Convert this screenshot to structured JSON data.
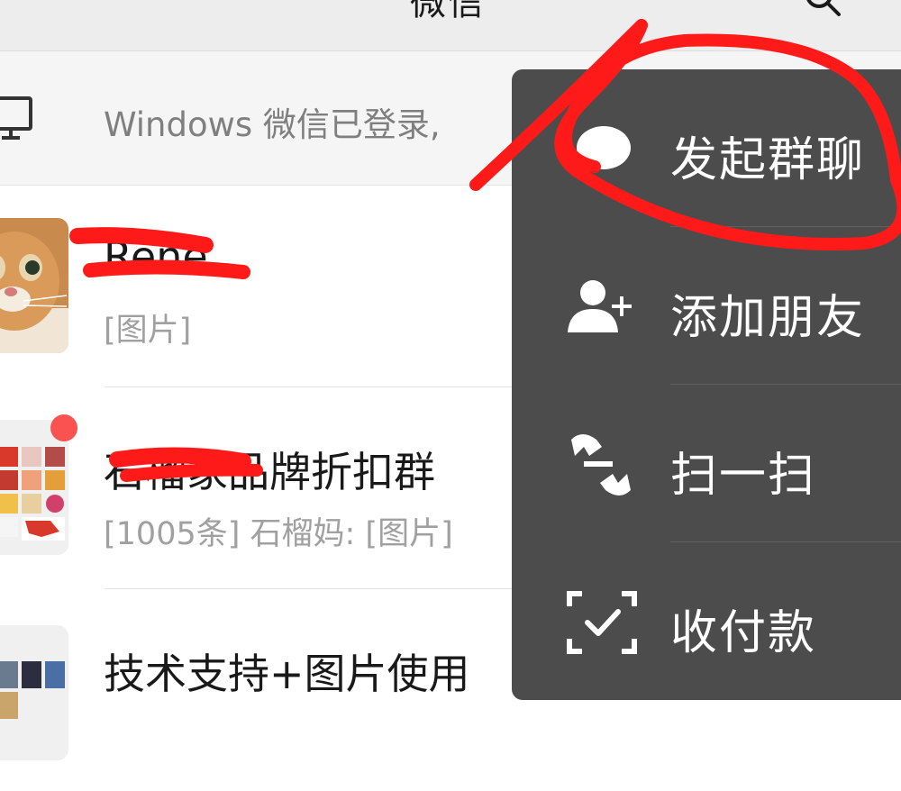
{
  "header": {
    "title": "微信",
    "search_icon": "search-icon"
  },
  "login_bar": {
    "icon": "desktop-icon",
    "text": "Windows 微信已登录,"
  },
  "chats": [
    {
      "name": "Rene",
      "name_redacted": true,
      "preview": "[图片]",
      "avatar": "cat-photo"
    },
    {
      "name": "石榴家品牌折扣群",
      "name_redacted": true,
      "preview": "[1005条] 石榴妈: [图片]",
      "avatar": "group-collage",
      "unread_dot": true
    },
    {
      "name": "技术支持+图片使用",
      "preview": "",
      "avatar": "group-collage"
    }
  ],
  "menu": {
    "items": [
      {
        "label": "发起群聊",
        "icon": "chat-bubble-icon"
      },
      {
        "label": "添加朋友",
        "icon": "add-friend-icon"
      },
      {
        "label": "扫一扫",
        "icon": "scan-icon"
      },
      {
        "label": "收付款",
        "icon": "payment-icon"
      }
    ]
  },
  "colors": {
    "menu_bg": "#4c4c4c",
    "header_bg": "#ededed",
    "annotation_red": "#ff1a1a",
    "unread_dot": "#fa5151"
  }
}
